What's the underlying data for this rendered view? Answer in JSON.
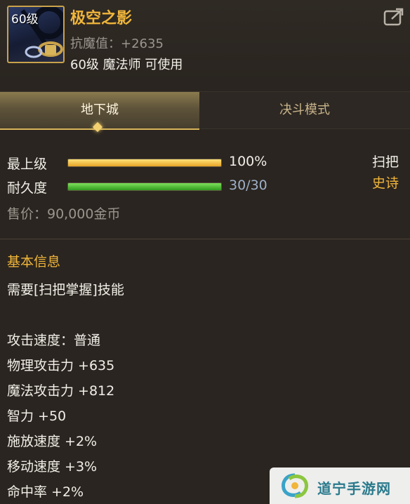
{
  "item": {
    "level_badge": "60级",
    "name": "极空之影",
    "stat_line": "抗魔值：+2635",
    "requirement": "60级 魔法师 可使用"
  },
  "tabs": [
    {
      "label": "地下城",
      "active": true
    },
    {
      "label": "决斗模式",
      "active": false
    }
  ],
  "bars": [
    {
      "label": "最上级",
      "value_text": "100%",
      "fraction": 1.0,
      "color": "#e6a426"
    },
    {
      "label": "耐久度",
      "value_text": "30/30",
      "fraction": 1.0,
      "color": "#2f9a1e"
    }
  ],
  "item_type": "扫把",
  "item_rarity": "史诗",
  "price": "售价：90,000金币",
  "basic_info": {
    "title": "基本信息",
    "requirement": "需要[扫把掌握]技能",
    "stats": [
      "攻击速度：普通",
      "物理攻击力 +635",
      "魔法攻击力 +812",
      "智力 +50",
      "施放速度 +2%",
      "移动速度 +3%",
      "命中率 +2%"
    ]
  },
  "watermark": {
    "text": "道宁手游网"
  },
  "colors": {
    "accent": "#f0b53a",
    "rarity": "#f0b53a",
    "durability": "#9fb0c8"
  }
}
